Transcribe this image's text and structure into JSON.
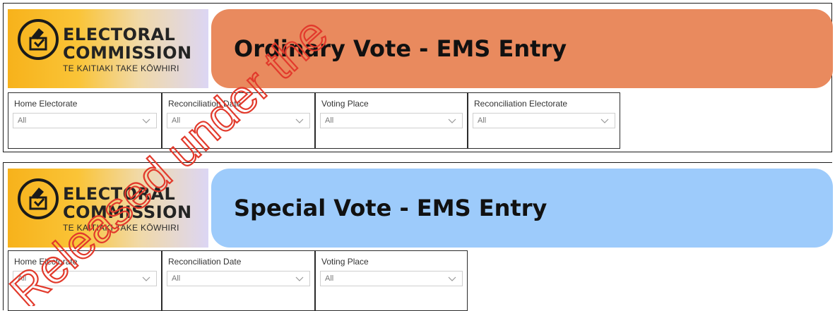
{
  "colors": {
    "ordinary_banner": "#e98a5e",
    "special_banner": "#9dcbfb",
    "watermark": "#e23a2c"
  },
  "logo": {
    "line1": "ELECTORAL",
    "line2": "COMMISSION",
    "line3": "TE KAITIAKI TAKE KŌWHIRI",
    "icon": "ballot-hand-icon"
  },
  "ordinary": {
    "title": "Ordinary Vote - EMS Entry",
    "filters": [
      {
        "label": "Home Electorate",
        "value": "All"
      },
      {
        "label": "Reconciliation Date",
        "value": "All"
      },
      {
        "label": "Voting Place",
        "value": "All"
      },
      {
        "label": "Reconciliation Electorate",
        "value": "All"
      }
    ]
  },
  "special": {
    "title": "Special Vote - EMS Entry",
    "filters": [
      {
        "label": "Home Electorate",
        "value": "All"
      },
      {
        "label": "Reconciliation Date",
        "value": "All"
      },
      {
        "label": "Voting Place",
        "value": "All"
      }
    ]
  },
  "watermark": {
    "text": "Released under the"
  }
}
